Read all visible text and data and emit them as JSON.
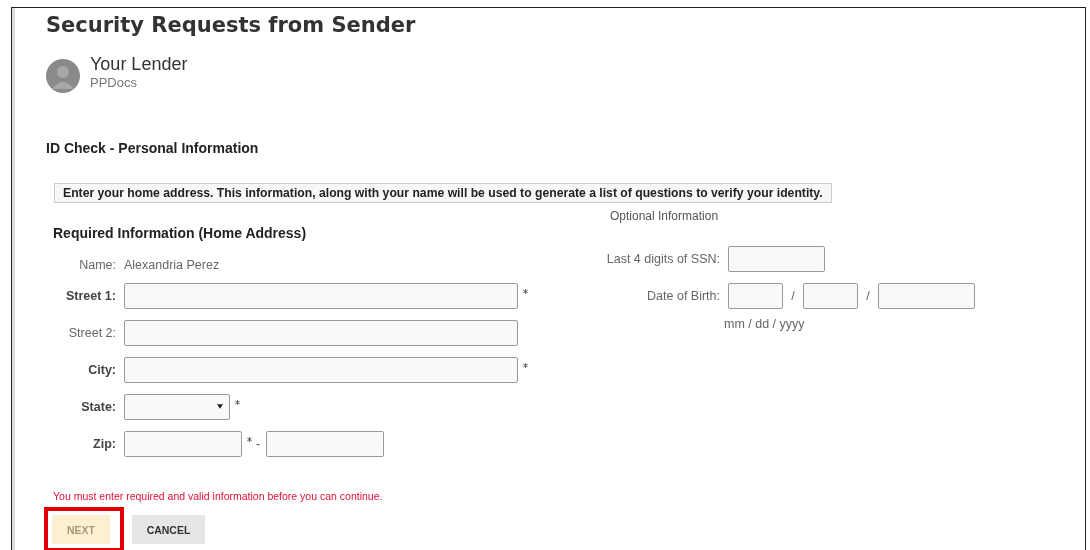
{
  "title": "Security Requests from Sender",
  "sender": {
    "name": "Your Lender",
    "company": "PPDocs"
  },
  "section_title": "ID Check - Personal Information",
  "notice": "Enter your home address. This information, along with your name will be used to generate a list of questions to verify your identity.",
  "required": {
    "heading": "Required Information (Home Address)",
    "name_label": "Name:",
    "name_value": "Alexandria Perez",
    "fields": [
      {
        "kind": "text",
        "label": "Street 1:",
        "required": true
      },
      {
        "kind": "text",
        "label": "Street 2:",
        "required": false
      },
      {
        "kind": "text",
        "label": "City:",
        "required": true
      },
      {
        "kind": "select",
        "label": "State:",
        "required": true
      },
      {
        "kind": "zip",
        "label": "Zip:",
        "required": true,
        "separator": "-"
      }
    ]
  },
  "optional": {
    "heading": "Optional Information",
    "ssn_label": "Last 4 digits of SSN:",
    "dob_label": "Date of Birth:",
    "dob_separators": [
      "/",
      "/"
    ],
    "dob_hint": "mm / dd / yyyy"
  },
  "error": "You must enter required and valid information before you can continue.",
  "buttons": [
    {
      "kind": "next",
      "label": "NEXT",
      "disabled": true,
      "highlighted": true
    },
    {
      "kind": "cancel",
      "label": "CANCEL",
      "disabled": false,
      "highlighted": false
    }
  ]
}
